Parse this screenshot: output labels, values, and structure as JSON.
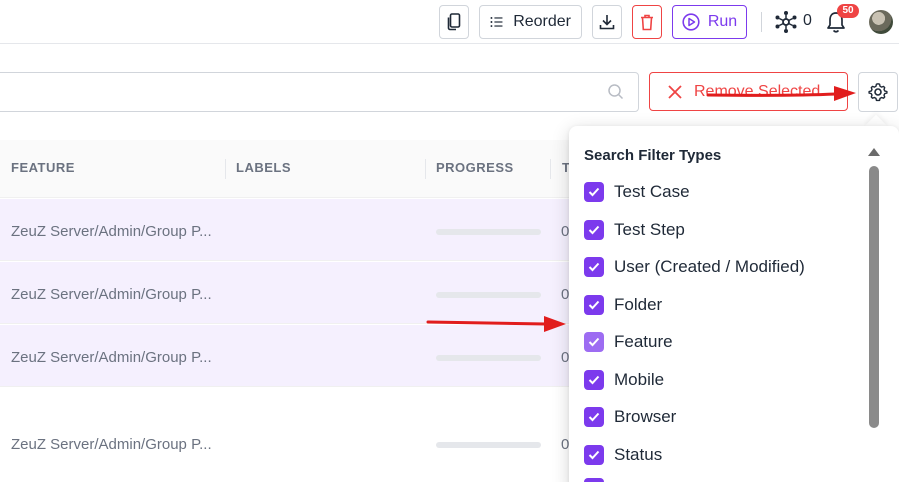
{
  "toolbar": {
    "reorder_label": "Reorder",
    "run_label": "Run",
    "nodes_count": "0",
    "notification_count": "50"
  },
  "search": {
    "value": "",
    "placeholder": ""
  },
  "actions": {
    "remove_selected_label": "Remove Selected"
  },
  "table": {
    "columns": [
      "FEATURE",
      "LABELS",
      "PROGRESS",
      "T"
    ],
    "rows": [
      {
        "feature": "ZeuZ Server/Admin/Group P...",
        "labels": "",
        "progress": 0,
        "t": "0",
        "selected": true
      },
      {
        "feature": "ZeuZ Server/Admin/Group P...",
        "labels": "",
        "progress": 0,
        "t": "0",
        "selected": true
      },
      {
        "feature": "ZeuZ Server/Admin/Group P...",
        "labels": "",
        "progress": 0,
        "t": "0",
        "selected": true
      },
      {
        "feature": "ZeuZ Server/Admin/Group P...",
        "labels": "",
        "progress": 0,
        "t": "0",
        "selected": false
      }
    ]
  },
  "filter_dropdown": {
    "title": "Search Filter Types",
    "items": [
      {
        "label": "Test Case",
        "checked": true
      },
      {
        "label": "Test Step",
        "checked": true
      },
      {
        "label": "User (Created / Modified)",
        "checked": true
      },
      {
        "label": "Folder",
        "checked": true
      },
      {
        "label": "Feature",
        "checked": true
      },
      {
        "label": "Mobile",
        "checked": true
      },
      {
        "label": "Browser",
        "checked": true
      },
      {
        "label": "Status",
        "checked": true
      }
    ]
  },
  "colors": {
    "accent": "#7c3aed",
    "danger": "#ef4444",
    "annotation_arrow": "#e11d1d"
  },
  "icons": [
    "copy-icon",
    "list-icon",
    "download-icon",
    "trash-icon",
    "play-circle-icon",
    "nodes-icon",
    "bell-icon",
    "avatar",
    "search-icon",
    "close-icon",
    "gear-icon",
    "check-icon"
  ]
}
